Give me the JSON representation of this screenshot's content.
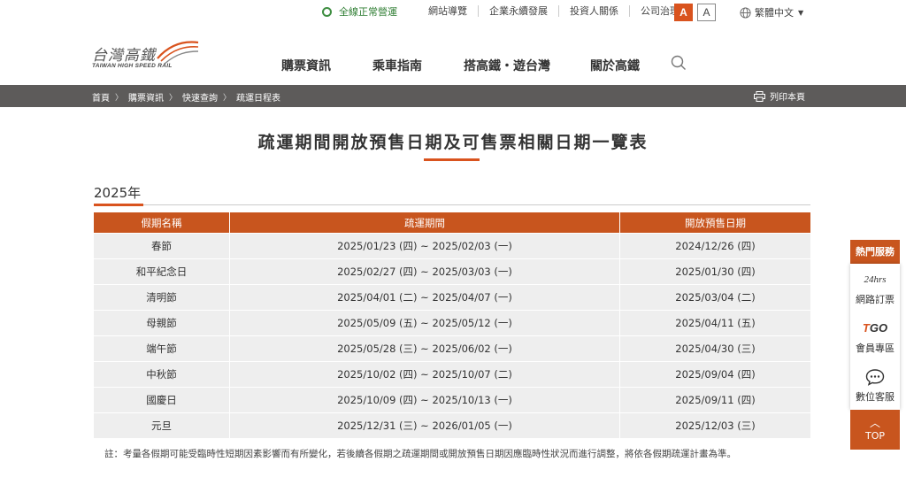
{
  "topbar": {
    "status_text": "全線正常營運",
    "links": [
      "網站導覽",
      "企業永續發展",
      "投資人關係",
      "公司治理"
    ],
    "font_large": "A",
    "font_small": "A",
    "language": "繁體中文"
  },
  "logo": {
    "name": "台灣高鐵",
    "sub": "TAIWAN HIGH SPEED RAIL"
  },
  "nav": {
    "items": [
      "購票資訊",
      "乘車指南",
      "搭高鐵・遊台灣",
      "關於高鐵"
    ]
  },
  "breadcrumb": {
    "items": [
      "首頁",
      "購票資訊",
      "快速查詢",
      "疏運日程表"
    ],
    "print_label": "列印本頁"
  },
  "page": {
    "title": "疏運期間開放預售日期及可售票相關日期一覽表",
    "year": "2025年",
    "note": "註：考量各假期可能受臨時性短期因素影響而有所變化，若後續各假期之疏運期間或開放預售日期因應臨時性狀況而進行調整，將依各假期疏運計畫為準。"
  },
  "table": {
    "headers": [
      "假期名稱",
      "疏運期間",
      "開放預售日期"
    ],
    "rows": [
      [
        "春節",
        "2025/01/23 (四) ~ 2025/02/03 (一)",
        "2024/12/26 (四)"
      ],
      [
        "和平紀念日",
        "2025/02/27 (四) ~ 2025/03/03 (一)",
        "2025/01/30 (四)"
      ],
      [
        "清明節",
        "2025/04/01 (二) ~ 2025/04/07 (一)",
        "2025/03/04 (二)"
      ],
      [
        "母親節",
        "2025/05/09 (五) ~ 2025/05/12 (一)",
        "2025/04/11 (五)"
      ],
      [
        "端午節",
        "2025/05/28 (三) ~ 2025/06/02 (一)",
        "2025/04/30 (三)"
      ],
      [
        "中秋節",
        "2025/10/02 (四) ~ 2025/10/07 (二)",
        "2025/09/04 (四)"
      ],
      [
        "國慶日",
        "2025/10/09 (四) ~ 2025/10/13 (一)",
        "2025/09/11 (四)"
      ],
      [
        "元旦",
        "2025/12/31 (三) ~ 2026/01/05 (一)",
        "2025/12/03 (三)"
      ]
    ]
  },
  "side_panel": {
    "title": "熱門服務",
    "items": [
      {
        "icon_text": "24hrs",
        "label": "網路訂票",
        "icon": "24hrs-icon"
      },
      {
        "icon_text": "TGO",
        "label": "會員專區",
        "icon": "tgo-icon"
      },
      {
        "icon_text": "",
        "label": "數位客服",
        "icon": "chat-icon"
      }
    ],
    "top_label": "TOP"
  },
  "colors": {
    "accent": "#c8551e",
    "status_green": "#3e8e41",
    "breadcrumb_bg": "#5d5b5a",
    "row_bg": "#eeeeee"
  }
}
